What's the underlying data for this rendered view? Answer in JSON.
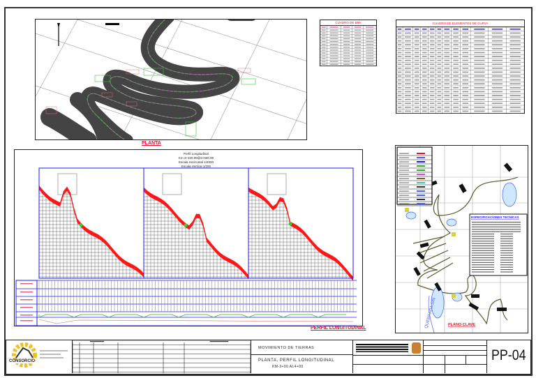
{
  "sheet": {
    "code": "PP-04",
    "company": "CONSORCIO",
    "work_title": "MOVIMIENTO DE TIERRAS",
    "plan_title": "PLANTA, PERFIL LONGITUDINAL",
    "plan_range": "KM-3+00 AL4+00"
  },
  "planta": {
    "label": "PLANTA"
  },
  "tables": {
    "bm_title": "CUADRO DE BMs",
    "curve_title": "CUADRO DE ELEMENTOS DE CURVA"
  },
  "profile": {
    "title": "Perfil Longitudinal",
    "range": "Km 3+330.00@3+660.00",
    "scale_h": "Escala Horizontal 1/2000",
    "scale_v": "Escala Vertical 1/200",
    "label": "PERFIL LONGITUDINAL"
  },
  "clave": {
    "label": "PLANO CLAVE",
    "specs_title": "ESPECIFICACIONES TECNICAS",
    "river": "QUEBRADA S/N"
  },
  "colors": {
    "accent_red": "#e8102a",
    "frame_blue": "#1a1aff",
    "road_gray": "#444444",
    "center_green": "#3fbf3f",
    "cut_red": "#ff0000"
  }
}
